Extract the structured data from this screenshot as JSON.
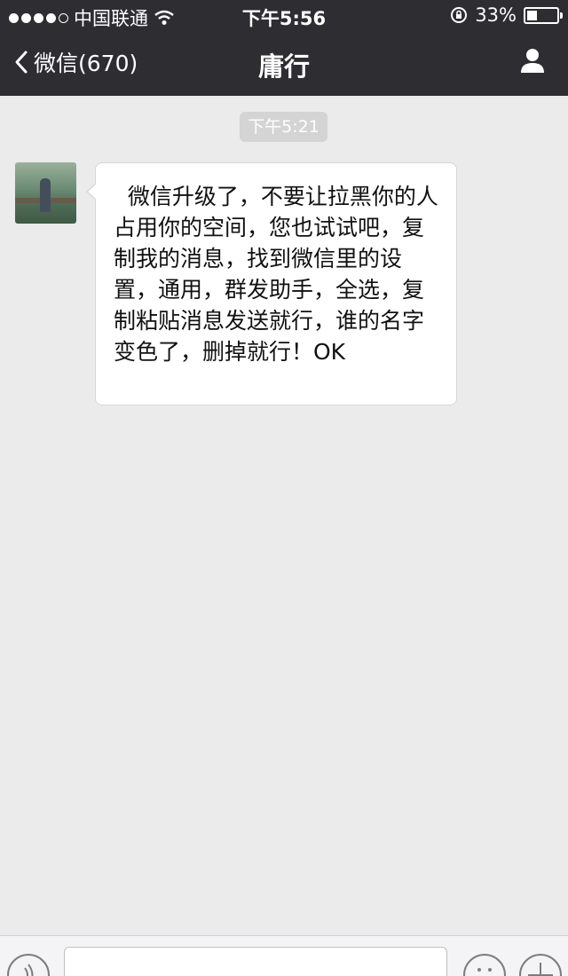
{
  "status_bar": {
    "carrier": "中国联通",
    "time": "下午5:56",
    "battery": "33%",
    "battery_level": 0.33,
    "signal_icon": "signal-dots-icon",
    "wifi_icon": "wifi-icon",
    "lock_icon": "rotation-lock-icon"
  },
  "nav": {
    "back_label": "微信(670)",
    "title": "庸行",
    "profile_icon": "person-icon"
  },
  "chat": {
    "timestamp": "下午5:21",
    "messages": [
      {
        "text": "  微信升级了，不要让拉黑你的人占用你的空间，您也试试吧，复制我的消息，找到微信里的设置，通用，群发助手，全选，复制粘贴消息发送就行，谁的名字变色了，删掉就行！OK"
      }
    ]
  },
  "input_bar": {
    "voice_icon": "voice-icon",
    "emoji_icon": "emoji-icon",
    "plus_icon": "plus-icon"
  },
  "colors": {
    "header_bg": "#2e2d32",
    "chat_bg": "#ebebeb",
    "bubble_bg": "#ffffff"
  }
}
